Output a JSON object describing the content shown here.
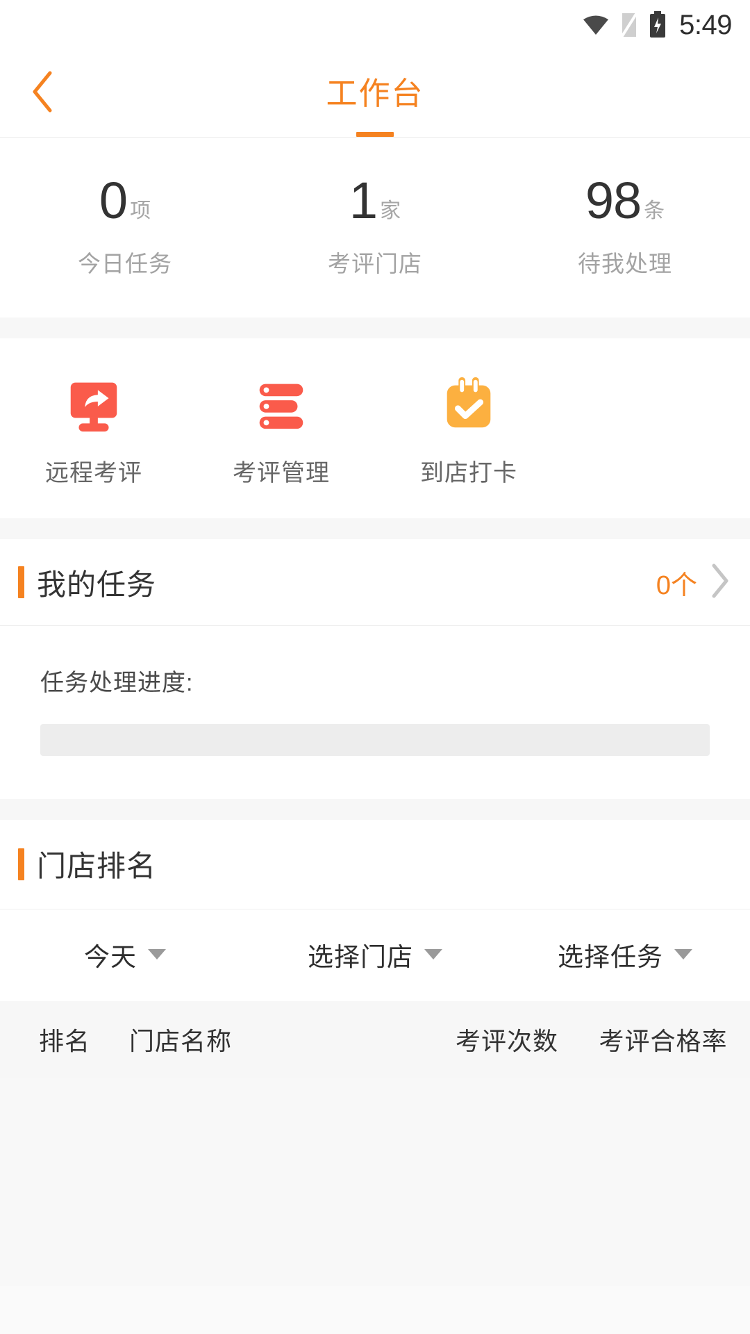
{
  "status_bar": {
    "time": "5:49",
    "icons": [
      "wifi-icon",
      "sim-card-icon",
      "battery-charging-icon"
    ]
  },
  "nav": {
    "title": "工作台",
    "back_icon": "chevron-left-icon",
    "accent_color": "#f58220"
  },
  "stats": [
    {
      "value": "0",
      "unit": "项",
      "label": "今日任务"
    },
    {
      "value": "1",
      "unit": "家",
      "label": "考评门店"
    },
    {
      "value": "98",
      "unit": "条",
      "label": "待我处理"
    }
  ],
  "quick_actions": [
    {
      "label": "远程考评",
      "icon": "monitor-share-icon",
      "color": "#fa5b4b"
    },
    {
      "label": "考评管理",
      "icon": "list-bars-icon",
      "color": "#fa5b4b"
    },
    {
      "label": "到店打卡",
      "icon": "calendar-check-icon",
      "color": "#fcb040"
    }
  ],
  "my_tasks": {
    "title": "我的任务",
    "count": "0个",
    "chevron_icon": "chevron-right-icon",
    "progress_label": "任务处理进度:",
    "progress_percent": 0
  },
  "store_ranking": {
    "title": "门店排名",
    "filters": [
      {
        "label": "今天",
        "caret_icon": "caret-down-icon"
      },
      {
        "label": "选择门店",
        "caret_icon": "caret-down-icon"
      },
      {
        "label": "选择任务",
        "caret_icon": "caret-down-icon"
      }
    ],
    "columns": [
      "排名",
      "门店名称",
      "考评次数",
      "考评合格率"
    ],
    "rows": []
  }
}
